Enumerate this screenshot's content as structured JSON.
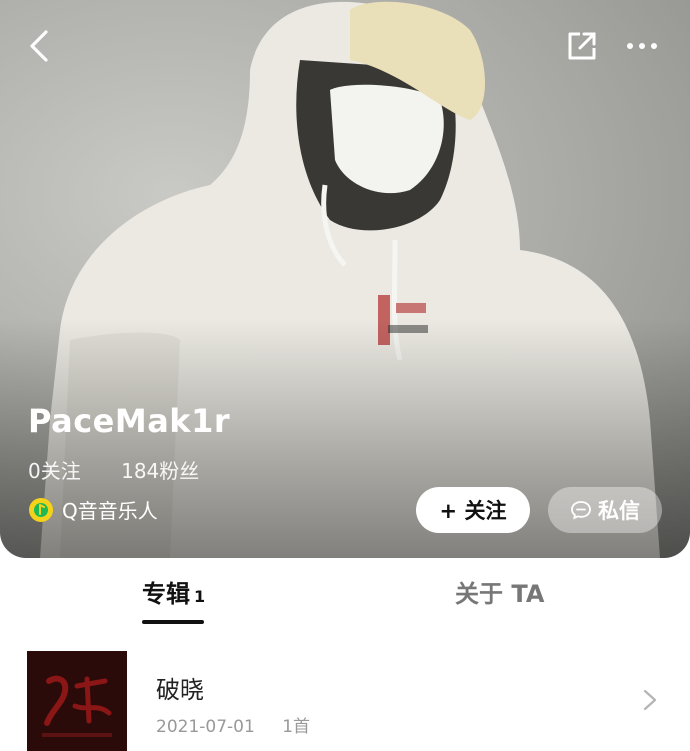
{
  "profile": {
    "name": "PaceMak1r",
    "following": "0关注",
    "followers": "184粉丝",
    "badge_label": "Q音音乐人"
  },
  "actions": {
    "follow_label": "+ 关注",
    "message_label": "私信"
  },
  "tabs": [
    {
      "label": "专辑",
      "count": "1",
      "active": true
    },
    {
      "label": "关于 TA",
      "active": false
    }
  ],
  "albums": [
    {
      "title": "破晓",
      "date": "2021-07-01",
      "tracks": "1首"
    }
  ],
  "icons": {
    "back": "chevron-left-icon",
    "share": "share-icon",
    "more": "more-icon",
    "message": "chat-bubble-icon",
    "chevron": "chevron-right-icon"
  },
  "colors": {
    "badge_yellow": "#f5d21a",
    "badge_green": "#1db954"
  }
}
